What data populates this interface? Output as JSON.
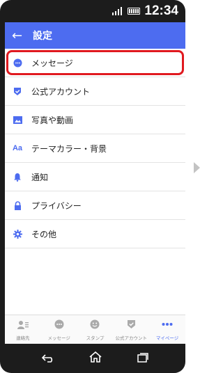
{
  "status": {
    "time": "12:34"
  },
  "header": {
    "title": "設定"
  },
  "settings": {
    "items": [
      {
        "label": "メッセージ",
        "icon": "chat-bubble-icon",
        "highlighted": true
      },
      {
        "label": "公式アカウント",
        "icon": "shield-check-icon"
      },
      {
        "label": "写真や動画",
        "icon": "image-icon"
      },
      {
        "label": "テーマカラー・背景",
        "icon": "text-aa-icon",
        "glyph": "Aa"
      },
      {
        "label": "通知",
        "icon": "bell-icon"
      },
      {
        "label": "プライバシー",
        "icon": "lock-icon"
      },
      {
        "label": "その他",
        "icon": "gear-icon"
      }
    ]
  },
  "tabs": [
    {
      "label": "連絡先",
      "icon": "contacts-icon"
    },
    {
      "label": "メッセージ",
      "icon": "message-icon"
    },
    {
      "label": "スタンプ",
      "icon": "sticker-icon"
    },
    {
      "label": "公式アカウント",
      "icon": "official-account-icon"
    },
    {
      "label": "マイページ",
      "icon": "more-dots-icon",
      "active": true
    }
  ],
  "colors": {
    "accent": "#4d6cf0",
    "highlight": "#e0191f",
    "icon": "#4d6cf0",
    "tab_inactive": "#aaaaaa"
  }
}
